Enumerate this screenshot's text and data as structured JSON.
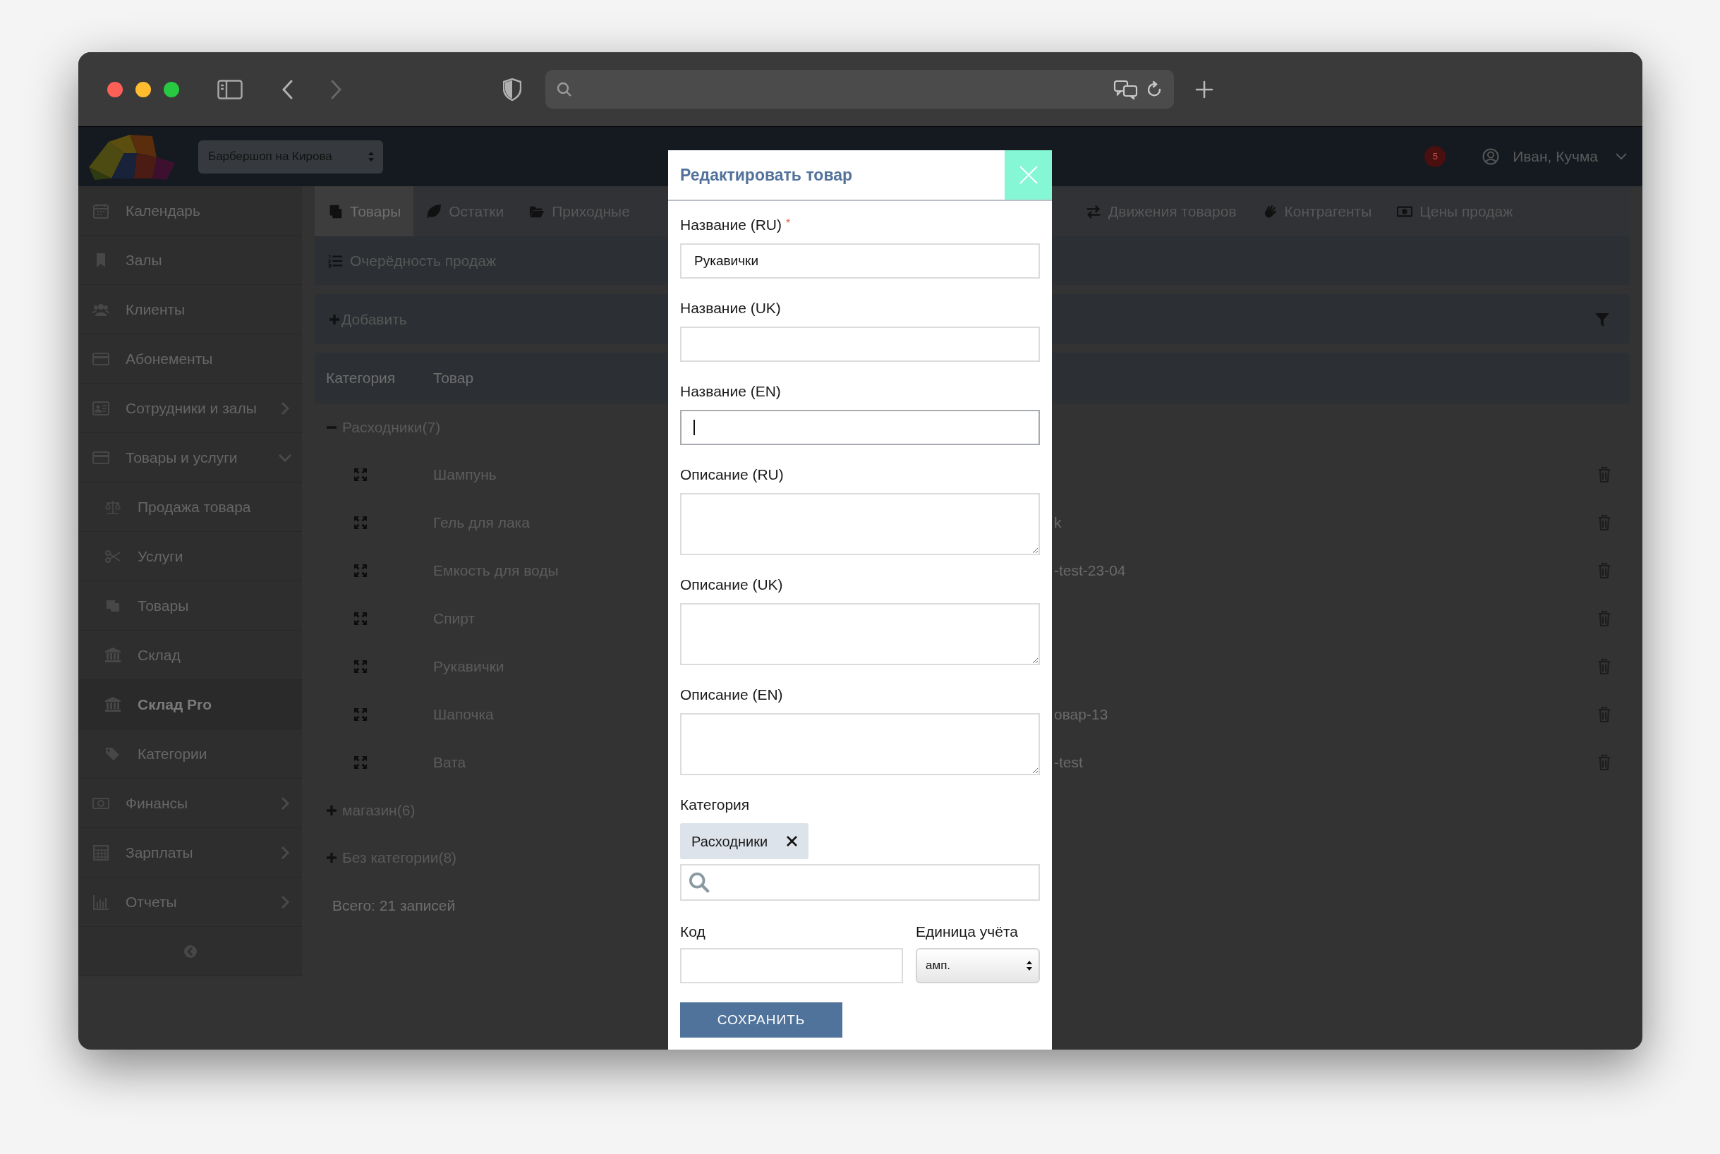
{
  "header": {
    "location": "Барбершоп на Кирова",
    "notifications": "5",
    "user": "Иван, Кучма"
  },
  "sidebar": {
    "items": [
      {
        "label": "Календарь",
        "selected": false
      },
      {
        "label": "Залы",
        "selected": false
      },
      {
        "label": "Клиенты",
        "selected": false
      },
      {
        "label": "Абонементы",
        "selected": false
      },
      {
        "label": "Сотрудники и залы",
        "selected": false,
        "expanded": false
      },
      {
        "label": "Товары и услуги",
        "selected": false,
        "expanded": true,
        "children": [
          {
            "label": "Продажа товара",
            "selected": false
          },
          {
            "label": "Услуги",
            "selected": false
          },
          {
            "label": "Товары",
            "selected": false
          },
          {
            "label": "Склад",
            "selected": false
          },
          {
            "label": "Склад Pro",
            "selected": true
          },
          {
            "label": "Категории",
            "selected": false
          }
        ]
      },
      {
        "label": "Финансы",
        "selected": false,
        "expanded": false
      },
      {
        "label": "Зарплаты",
        "selected": false,
        "expanded": false
      },
      {
        "label": "Отчеты",
        "selected": false,
        "expanded": false
      }
    ]
  },
  "tabs": [
    {
      "label": "Товары",
      "selected": true
    },
    {
      "label": "Остатки",
      "selected": false
    },
    {
      "label": "Приходные",
      "selected": false
    },
    {
      "label": "Движения товаров",
      "selected": false
    },
    {
      "label": "Контрагенты",
      "selected": false
    },
    {
      "label": "Цены продаж",
      "selected": false
    }
  ],
  "subtabs": [
    {
      "label": "Очерёдность продаж",
      "selected": false
    }
  ],
  "toolbar": {
    "add": "Добавить"
  },
  "table": {
    "columns": [
      "Категория",
      "Товар"
    ],
    "groups": [
      {
        "label": "Расходники(7)",
        "expanded": true,
        "rows": [
          {
            "name": "Шампунь"
          },
          {
            "name": "Гель для лака",
            "column_3": "k"
          },
          {
            "name": "Емкость для воды",
            "column_3": "-test-23-04"
          },
          {
            "name": "Спирт"
          },
          {
            "name": "Рукавички"
          },
          {
            "name": "Шапочка",
            "column_3": "овар-13"
          },
          {
            "name": "Вата",
            "column_3": "-test"
          }
        ]
      },
      {
        "label": "магазин(6)",
        "expanded": false
      },
      {
        "label": "Без категории(8)",
        "expanded": false
      }
    ],
    "total": "Всего: 21 записей"
  },
  "modal": {
    "title": "Редактировать товар",
    "fields": [
      {
        "kind": "input",
        "label": "Название (RU)",
        "required_mark": "*",
        "focused": false,
        "value": "Рукавички"
      },
      {
        "kind": "input",
        "label": "Название (UK)",
        "focused": false
      },
      {
        "kind": "input",
        "label": "Название (EN)",
        "focused": true
      },
      {
        "kind": "textarea",
        "label": "Описание (RU)"
      },
      {
        "kind": "textarea",
        "label": "Описание (UK)"
      },
      {
        "kind": "textarea",
        "label": "Описание (EN)"
      },
      {
        "kind": "tags",
        "label": "Категория",
        "tags": [
          "Расходники"
        ]
      }
    ],
    "code": {
      "label": "Код"
    },
    "unit": {
      "label": "Единица учёта",
      "value": "амп."
    },
    "save": "СОХРАНИТЬ"
  }
}
